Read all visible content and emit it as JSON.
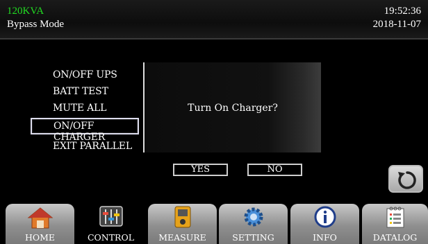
{
  "header": {
    "model": "120KVA",
    "mode": "Bypass Mode",
    "time": "19:52:36",
    "date": "2018-11-07"
  },
  "menu": {
    "items": [
      {
        "label": "ON/OFF UPS"
      },
      {
        "label": "BATT TEST"
      },
      {
        "label": "MUTE ALL"
      },
      {
        "label": "ON/OFF CHARGER",
        "selected": true
      },
      {
        "label": "EXIT PARALLEL"
      }
    ]
  },
  "dialog": {
    "message": "Turn On Charger?",
    "yes_label": "YES",
    "no_label": "NO"
  },
  "back_button": {
    "icon": "refresh-icon"
  },
  "nav": {
    "active": "CONTROL",
    "tabs": [
      {
        "label": "HOME",
        "icon": "home-icon"
      },
      {
        "label": "CONTROL",
        "icon": "sliders-icon"
      },
      {
        "label": "MEASURE",
        "icon": "meter-icon"
      },
      {
        "label": "SETTING",
        "icon": "gear-icon"
      },
      {
        "label": "INFO",
        "icon": "info-icon"
      },
      {
        "label": "DATALOG",
        "icon": "log-icon"
      }
    ]
  },
  "colors": {
    "model_text": "#22dd22",
    "background": "#000000",
    "tab_gradient_top": "#c8c8c8"
  }
}
